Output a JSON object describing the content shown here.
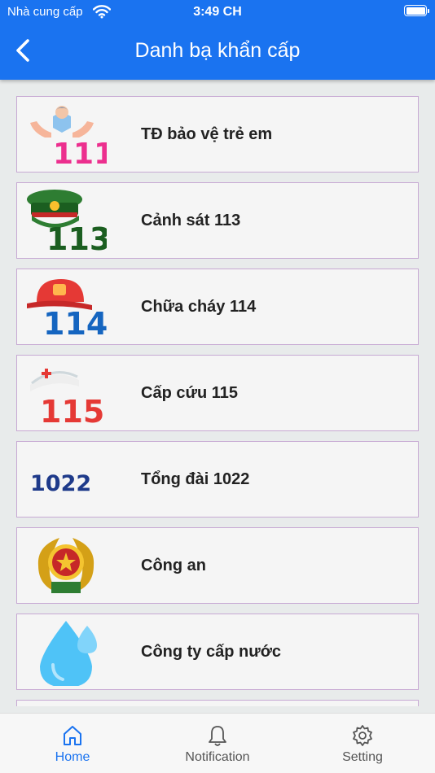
{
  "status_bar": {
    "carrier": "Nhà cung cấp",
    "time": "3:49 CH"
  },
  "header": {
    "title": "Danh bạ khẩn cấp",
    "back_icon": "chevron-left-icon"
  },
  "colors": {
    "primary": "#1a73f0",
    "card_border": "#c7a9d3",
    "card_bg": "#f5f5f5",
    "background": "#e8ebeb"
  },
  "contacts": [
    {
      "label": "TĐ bảo vệ trẻ em",
      "icon": "child-protection-111-icon",
      "icon_text": "111"
    },
    {
      "label": "Cảnh sát 113",
      "icon": "police-113-icon",
      "icon_text": "113"
    },
    {
      "label": "Chữa cháy 114",
      "icon": "firefighter-114-icon",
      "icon_text": "114"
    },
    {
      "label": "Cấp cứu 115",
      "icon": "ambulance-115-icon",
      "icon_text": "115"
    },
    {
      "label": "Tổng đài 1022",
      "icon": "hotline-1022-icon",
      "icon_text": "1022"
    },
    {
      "label": "Công an",
      "icon": "police-emblem-icon"
    },
    {
      "label": "Công ty cấp nước",
      "icon": "water-drop-icon"
    }
  ],
  "tabs": [
    {
      "label": "Home",
      "icon": "home-icon",
      "active": true
    },
    {
      "label": "Notification",
      "icon": "bell-icon",
      "active": false
    },
    {
      "label": "Setting",
      "icon": "gear-icon",
      "active": false
    }
  ]
}
